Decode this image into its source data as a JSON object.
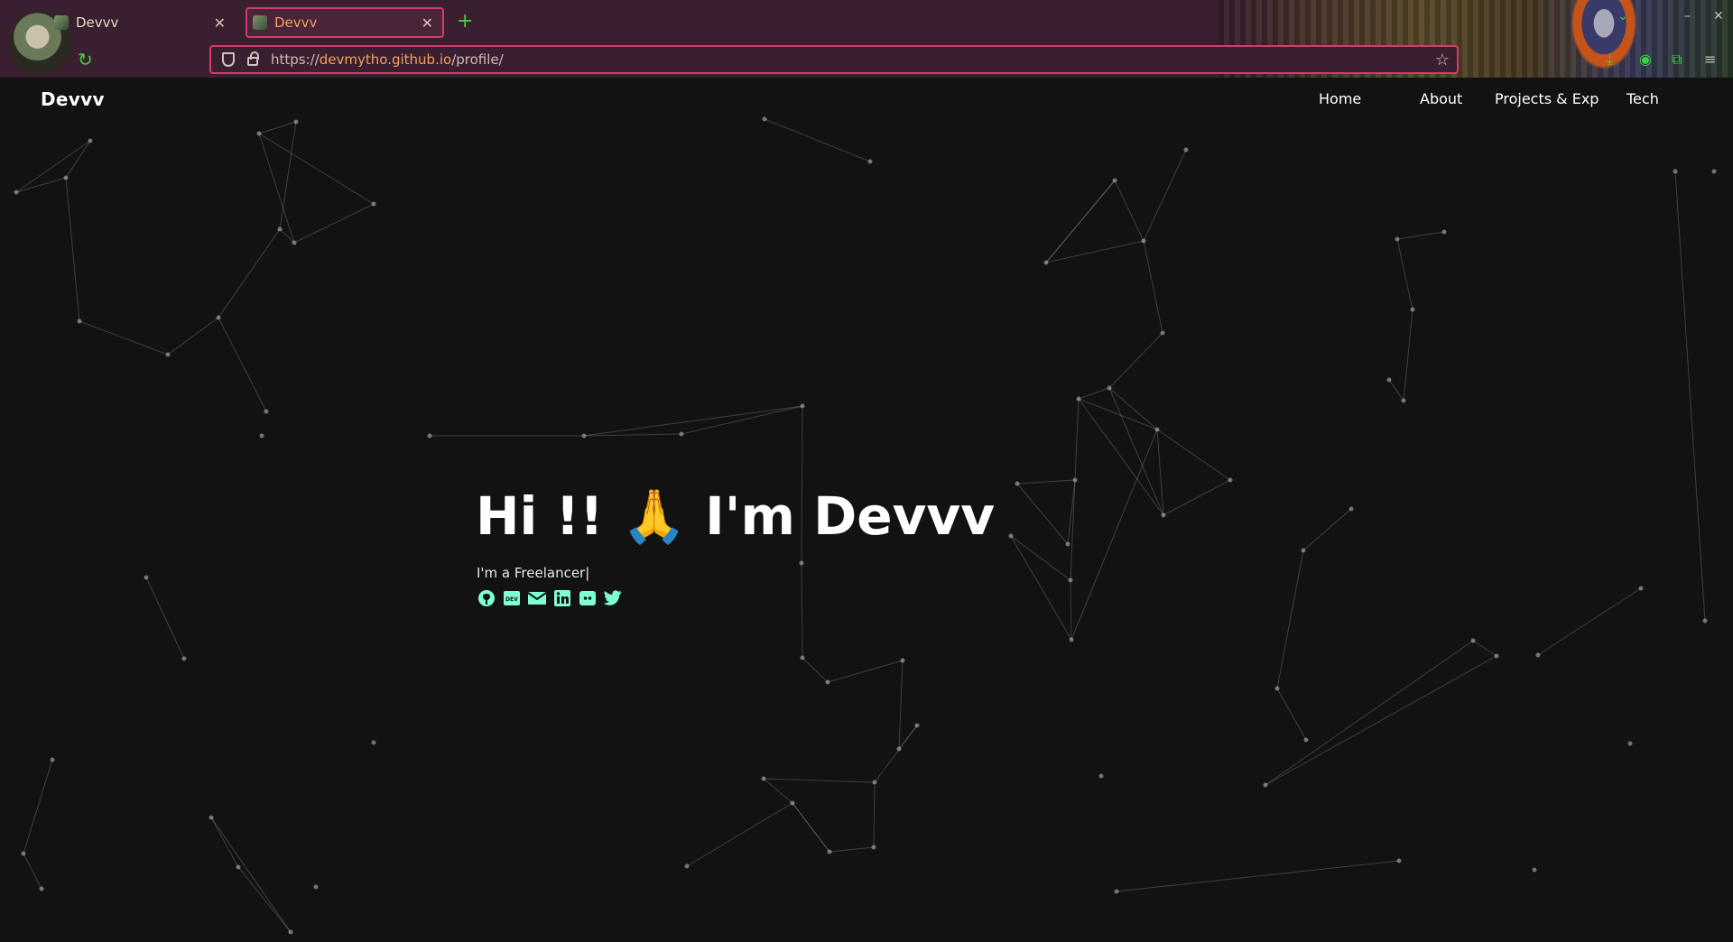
{
  "browser": {
    "tabs": [
      {
        "title": "Devvv",
        "active": false
      },
      {
        "title": "Devvv",
        "active": true
      }
    ],
    "url": {
      "scheme": "https://",
      "domain": "devmytho.github.io",
      "path": "/profile/"
    }
  },
  "nav": {
    "brand": "Devvv",
    "links": [
      "Home",
      "About",
      "Projects & Exp",
      "Tech"
    ]
  },
  "hero": {
    "title_pre": "Hi !! ",
    "emoji": "🙏",
    "title_post": " I'm Devvv",
    "subtitle": "I'm a Freelancer|",
    "socials": [
      "github-icon",
      "dev-icon",
      "mail-icon",
      "linkedin-icon",
      "discord-icon",
      "twitter-icon"
    ]
  },
  "colors": {
    "accent": "#7fffd4",
    "background": "#121212",
    "browser_accent": "#d63a6a",
    "browser_green": "#3ed13e"
  }
}
